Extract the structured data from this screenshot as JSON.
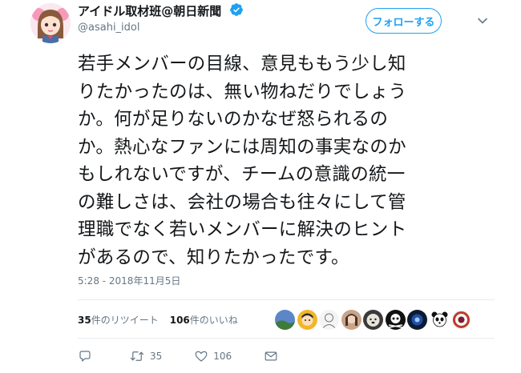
{
  "author": {
    "name": "アイドル取材班@朝日新聞",
    "handle": "@asahi_idol",
    "verified": true,
    "avatar_icon": "anime-girl-avatar-icon"
  },
  "follow_button": {
    "label": "フォローする"
  },
  "tweet": {
    "lines": [
      "若手メンバーの目線、意見ももう少し知",
      "りたかったのは、無い物ねだりでしょう",
      "か。何が足りないのかなぜ怒られるの",
      "か。熱心なファンには周知の事実なのか",
      "もしれないですが、チームの意識の統一",
      "の難しさは、会社の場合も往々にして管",
      "理職でなく若いメンバーに解決のヒント",
      "があるので、知りたかったです。"
    ],
    "timestamp": "5:28 - 2018年11月5日"
  },
  "stats": {
    "retweets_count": "35",
    "retweets_label": "件のリツイート",
    "likes_count": "106",
    "likes_label": "件のいいね"
  },
  "likers": [
    {
      "icon": "landscape-avatar-icon"
    },
    {
      "icon": "cartoon-face-avatar-icon"
    },
    {
      "icon": "sketch-avatar-icon"
    },
    {
      "icon": "portrait-avatar-icon"
    },
    {
      "icon": "dog-avatar-icon"
    },
    {
      "icon": "skull-avatar-icon"
    },
    {
      "icon": "dark-avatar-icon"
    },
    {
      "icon": "panda-avatar-icon"
    },
    {
      "icon": "ring-avatar-icon"
    }
  ],
  "actions": {
    "reply_icon": "reply-icon",
    "retweet_count": "35",
    "like_count": "106",
    "dm_icon": "mail-icon"
  },
  "colors": {
    "accent": "#1da1f2",
    "text": "#14171a",
    "muted": "#657786",
    "divider": "#e6ecf0"
  }
}
